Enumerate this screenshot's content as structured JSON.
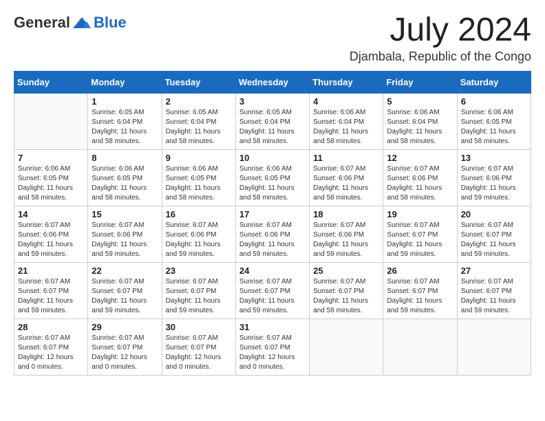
{
  "logo": {
    "general": "General",
    "blue": "Blue"
  },
  "title": {
    "month": "July 2024",
    "location": "Djambala, Republic of the Congo"
  },
  "days_of_week": [
    "Sunday",
    "Monday",
    "Tuesday",
    "Wednesday",
    "Thursday",
    "Friday",
    "Saturday"
  ],
  "weeks": [
    [
      {
        "day": "",
        "sunrise": "",
        "sunset": "",
        "daylight": ""
      },
      {
        "day": "1",
        "sunrise": "Sunrise: 6:05 AM",
        "sunset": "Sunset: 6:04 PM",
        "daylight": "Daylight: 11 hours and 58 minutes."
      },
      {
        "day": "2",
        "sunrise": "Sunrise: 6:05 AM",
        "sunset": "Sunset: 6:04 PM",
        "daylight": "Daylight: 11 hours and 58 minutes."
      },
      {
        "day": "3",
        "sunrise": "Sunrise: 6:05 AM",
        "sunset": "Sunset: 6:04 PM",
        "daylight": "Daylight: 11 hours and 58 minutes."
      },
      {
        "day": "4",
        "sunrise": "Sunrise: 6:06 AM",
        "sunset": "Sunset: 6:04 PM",
        "daylight": "Daylight: 11 hours and 58 minutes."
      },
      {
        "day": "5",
        "sunrise": "Sunrise: 6:06 AM",
        "sunset": "Sunset: 6:04 PM",
        "daylight": "Daylight: 11 hours and 58 minutes."
      },
      {
        "day": "6",
        "sunrise": "Sunrise: 6:06 AM",
        "sunset": "Sunset: 6:05 PM",
        "daylight": "Daylight: 11 hours and 58 minutes."
      }
    ],
    [
      {
        "day": "7",
        "sunrise": "Sunrise: 6:06 AM",
        "sunset": "Sunset: 6:05 PM",
        "daylight": "Daylight: 11 hours and 58 minutes."
      },
      {
        "day": "8",
        "sunrise": "Sunrise: 6:06 AM",
        "sunset": "Sunset: 6:05 PM",
        "daylight": "Daylight: 11 hours and 58 minutes."
      },
      {
        "day": "9",
        "sunrise": "Sunrise: 6:06 AM",
        "sunset": "Sunset: 6:05 PM",
        "daylight": "Daylight: 11 hours and 58 minutes."
      },
      {
        "day": "10",
        "sunrise": "Sunrise: 6:06 AM",
        "sunset": "Sunset: 6:05 PM",
        "daylight": "Daylight: 11 hours and 58 minutes."
      },
      {
        "day": "11",
        "sunrise": "Sunrise: 6:07 AM",
        "sunset": "Sunset: 6:06 PM",
        "daylight": "Daylight: 11 hours and 58 minutes."
      },
      {
        "day": "12",
        "sunrise": "Sunrise: 6:07 AM",
        "sunset": "Sunset: 6:06 PM",
        "daylight": "Daylight: 11 hours and 58 minutes."
      },
      {
        "day": "13",
        "sunrise": "Sunrise: 6:07 AM",
        "sunset": "Sunset: 6:06 PM",
        "daylight": "Daylight: 11 hours and 59 minutes."
      }
    ],
    [
      {
        "day": "14",
        "sunrise": "Sunrise: 6:07 AM",
        "sunset": "Sunset: 6:06 PM",
        "daylight": "Daylight: 11 hours and 59 minutes."
      },
      {
        "day": "15",
        "sunrise": "Sunrise: 6:07 AM",
        "sunset": "Sunset: 6:06 PM",
        "daylight": "Daylight: 11 hours and 59 minutes."
      },
      {
        "day": "16",
        "sunrise": "Sunrise: 6:07 AM",
        "sunset": "Sunset: 6:06 PM",
        "daylight": "Daylight: 11 hours and 59 minutes."
      },
      {
        "day": "17",
        "sunrise": "Sunrise: 6:07 AM",
        "sunset": "Sunset: 6:06 PM",
        "daylight": "Daylight: 11 hours and 59 minutes."
      },
      {
        "day": "18",
        "sunrise": "Sunrise: 6:07 AM",
        "sunset": "Sunset: 6:06 PM",
        "daylight": "Daylight: 11 hours and 59 minutes."
      },
      {
        "day": "19",
        "sunrise": "Sunrise: 6:07 AM",
        "sunset": "Sunset: 6:07 PM",
        "daylight": "Daylight: 11 hours and 59 minutes."
      },
      {
        "day": "20",
        "sunrise": "Sunrise: 6:07 AM",
        "sunset": "Sunset: 6:07 PM",
        "daylight": "Daylight: 11 hours and 59 minutes."
      }
    ],
    [
      {
        "day": "21",
        "sunrise": "Sunrise: 6:07 AM",
        "sunset": "Sunset: 6:07 PM",
        "daylight": "Daylight: 11 hours and 59 minutes."
      },
      {
        "day": "22",
        "sunrise": "Sunrise: 6:07 AM",
        "sunset": "Sunset: 6:07 PM",
        "daylight": "Daylight: 11 hours and 59 minutes."
      },
      {
        "day": "23",
        "sunrise": "Sunrise: 6:07 AM",
        "sunset": "Sunset: 6:07 PM",
        "daylight": "Daylight: 11 hours and 59 minutes."
      },
      {
        "day": "24",
        "sunrise": "Sunrise: 6:07 AM",
        "sunset": "Sunset: 6:07 PM",
        "daylight": "Daylight: 11 hours and 59 minutes."
      },
      {
        "day": "25",
        "sunrise": "Sunrise: 6:07 AM",
        "sunset": "Sunset: 6:07 PM",
        "daylight": "Daylight: 11 hours and 59 minutes."
      },
      {
        "day": "26",
        "sunrise": "Sunrise: 6:07 AM",
        "sunset": "Sunset: 6:07 PM",
        "daylight": "Daylight: 11 hours and 59 minutes."
      },
      {
        "day": "27",
        "sunrise": "Sunrise: 6:07 AM",
        "sunset": "Sunset: 6:07 PM",
        "daylight": "Daylight: 11 hours and 59 minutes."
      }
    ],
    [
      {
        "day": "28",
        "sunrise": "Sunrise: 6:07 AM",
        "sunset": "Sunset: 6:07 PM",
        "daylight": "Daylight: 12 hours and 0 minutes."
      },
      {
        "day": "29",
        "sunrise": "Sunrise: 6:07 AM",
        "sunset": "Sunset: 6:07 PM",
        "daylight": "Daylight: 12 hours and 0 minutes."
      },
      {
        "day": "30",
        "sunrise": "Sunrise: 6:07 AM",
        "sunset": "Sunset: 6:07 PM",
        "daylight": "Daylight: 12 hours and 0 minutes."
      },
      {
        "day": "31",
        "sunrise": "Sunrise: 6:07 AM",
        "sunset": "Sunset: 6:07 PM",
        "daylight": "Daylight: 12 hours and 0 minutes."
      },
      {
        "day": "",
        "sunrise": "",
        "sunset": "",
        "daylight": ""
      },
      {
        "day": "",
        "sunrise": "",
        "sunset": "",
        "daylight": ""
      },
      {
        "day": "",
        "sunrise": "",
        "sunset": "",
        "daylight": ""
      }
    ]
  ]
}
